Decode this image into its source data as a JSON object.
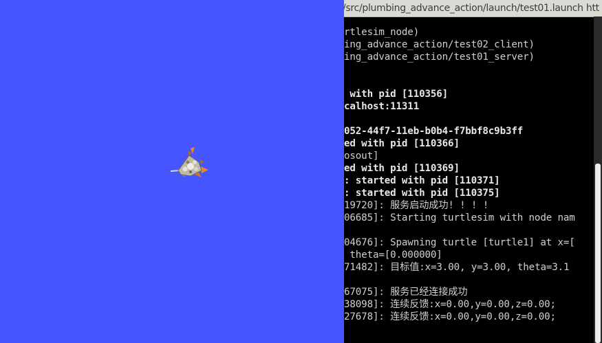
{
  "turtlesim": {
    "background": "#4556ff",
    "turtle_icon": "turtle-icon"
  },
  "terminal": {
    "title": "/src/plumbing_advance_action/launch/test01.launch htt",
    "lines": [
      {
        "text": "rtlesim_node)",
        "bold": false
      },
      {
        "text": "ing_advance_action/test02_client)",
        "bold": false
      },
      {
        "text": "ing_advance_action/test01_server)",
        "bold": false
      },
      {
        "text": "",
        "bold": false
      },
      {
        "text": "",
        "bold": false
      },
      {
        "text": " with pid [110356]",
        "bold": true
      },
      {
        "text": "calhost:11311",
        "bold": true
      },
      {
        "text": "",
        "bold": false
      },
      {
        "text": "052-44f7-11eb-b0b4-f7bbf8c9b3ff",
        "bold": true
      },
      {
        "text": "ed with pid [110366]",
        "bold": true
      },
      {
        "text": "osout]",
        "bold": false
      },
      {
        "text": "ed with pid [110369]",
        "bold": true
      },
      {
        "text": ": started with pid [110371]",
        "bold": true
      },
      {
        "text": ": started with pid [110375]",
        "bold": true
      },
      {
        "text": "19720]: 服务启动成功! ! ! !",
        "bold": false
      },
      {
        "text": "06685]: Starting turtlesim with node nam",
        "bold": false
      },
      {
        "text": "",
        "bold": false
      },
      {
        "text": "04676]: Spawning turtle [turtle1] at x=[",
        "bold": false
      },
      {
        "text": " theta=[0.000000]",
        "bold": false
      },
      {
        "text": "71482]: 目标值:x=3.00, y=3.00, theta=3.1",
        "bold": false
      },
      {
        "text": "",
        "bold": false
      },
      {
        "text": "67075]: 服务已经连接成功",
        "bold": false
      },
      {
        "text": "38098]: 连续反馈:x=0.00,y=0.00,z=0.00;",
        "bold": false
      },
      {
        "text": "27678]: 连续反馈:x=0.00,y=0.00,z=0.00;",
        "bold": false
      }
    ]
  }
}
